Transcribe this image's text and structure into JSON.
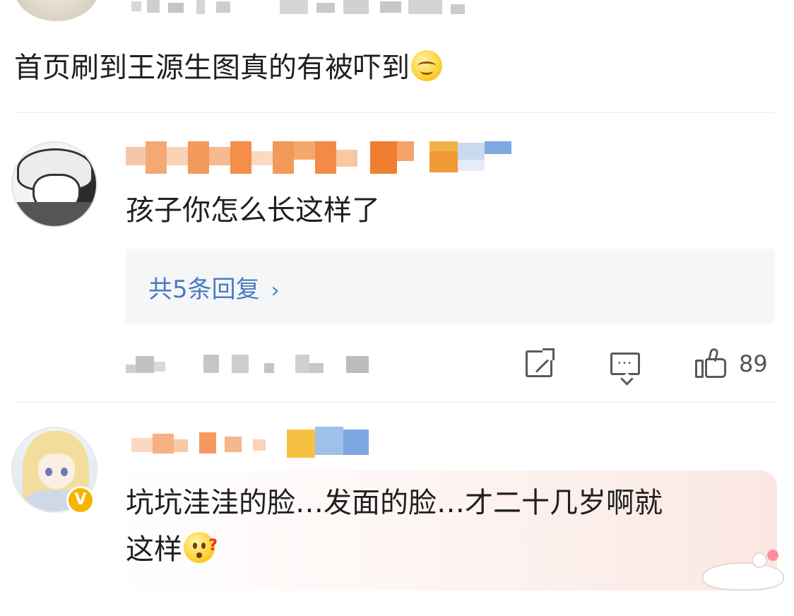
{
  "comments": [
    {
      "text": "首页刷到王源生图真的有被吓到",
      "emoji": "smirk-emoji"
    },
    {
      "text": "孩子你怎么长这样了",
      "reply_link": "共5条回复",
      "reply_chevron": "›",
      "like_count": "89"
    },
    {
      "text_line1": "坑坑洼洼的脸…发面的脸…才二十几岁啊就",
      "text_line2": "这样",
      "emoji": "confused-emoji",
      "verified_badge": "V"
    }
  ],
  "icons": {
    "forward": "forward-icon",
    "comment": "comment-icon",
    "like": "thumbs-up-icon"
  },
  "colors": {
    "link": "#4a7bbf",
    "badge": "#f6b400"
  }
}
